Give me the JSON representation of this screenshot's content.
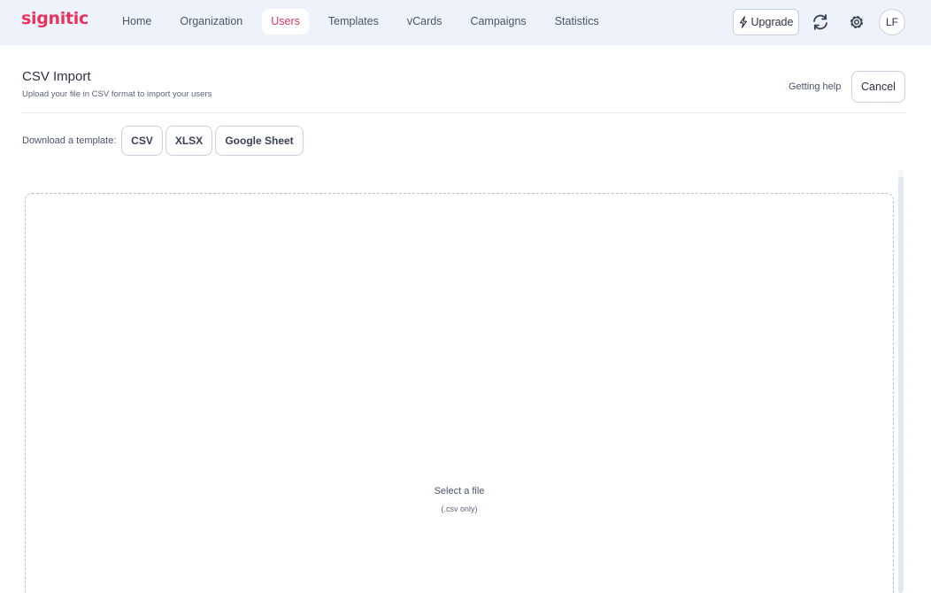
{
  "app": {
    "logo": "signitic"
  },
  "nav": {
    "items": [
      {
        "label": "Home"
      },
      {
        "label": "Organization"
      },
      {
        "label": "Users",
        "active": true
      },
      {
        "label": "Templates"
      },
      {
        "label": "vCards"
      },
      {
        "label": "Campaigns"
      },
      {
        "label": "Statistics"
      }
    ],
    "upgrade_label": "Upgrade",
    "upgrade_icon": "lightning-icon",
    "sync_icon": "sync-icon",
    "settings_icon": "gear-icon",
    "avatar_initials": "LF"
  },
  "page": {
    "title": "CSV Import",
    "subtitle": "Upload your file in CSV format to import your users",
    "help_label": "Getting help",
    "cancel_label": "Cancel"
  },
  "templates": {
    "label": "Download a template:",
    "buttons": [
      "CSV",
      "XLSX",
      "Google Sheet"
    ]
  },
  "dropzone": {
    "title": "Select a file",
    "hint": "(.csv only)"
  },
  "colors": {
    "brand": "#e8345c",
    "topbar_bg": "#eef3fb",
    "border": "#c9d1de"
  }
}
